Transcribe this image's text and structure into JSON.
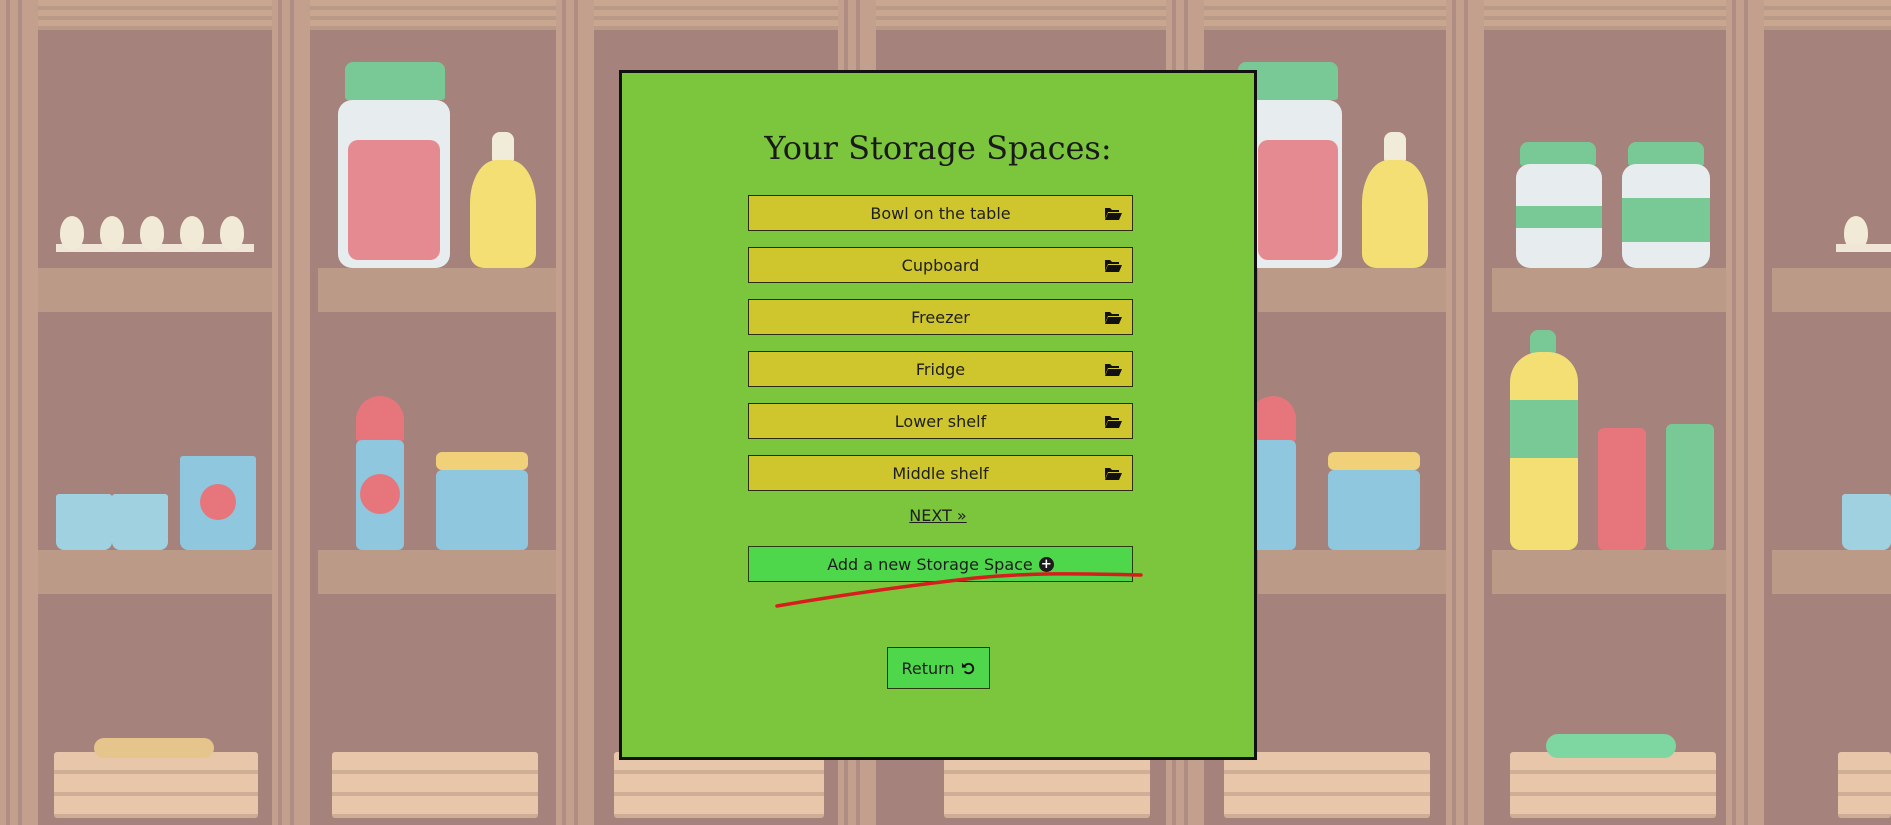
{
  "panel": {
    "title": "Your Storage Spaces:",
    "storage_spaces": [
      {
        "label": "Bowl on the table",
        "icon": "folder-open-icon"
      },
      {
        "label": "Cupboard",
        "icon": "folder-open-icon"
      },
      {
        "label": "Freezer",
        "icon": "folder-open-icon"
      },
      {
        "label": "Fridge",
        "icon": "folder-open-icon"
      },
      {
        "label": "Lower shelf",
        "icon": "folder-open-icon"
      },
      {
        "label": "Middle shelf",
        "icon": "folder-open-icon"
      }
    ],
    "next_label": "NEXT »",
    "add_label": "Add a new Storage Space",
    "add_icon": "plus-circle-icon",
    "return_label": "Return",
    "return_icon": "undo-icon"
  },
  "colors": {
    "panel_bg": "#7cc63d",
    "storage_button": "#cfc52c",
    "action_button": "#4ed74a",
    "annotation_stroke": "#d81d1d"
  }
}
